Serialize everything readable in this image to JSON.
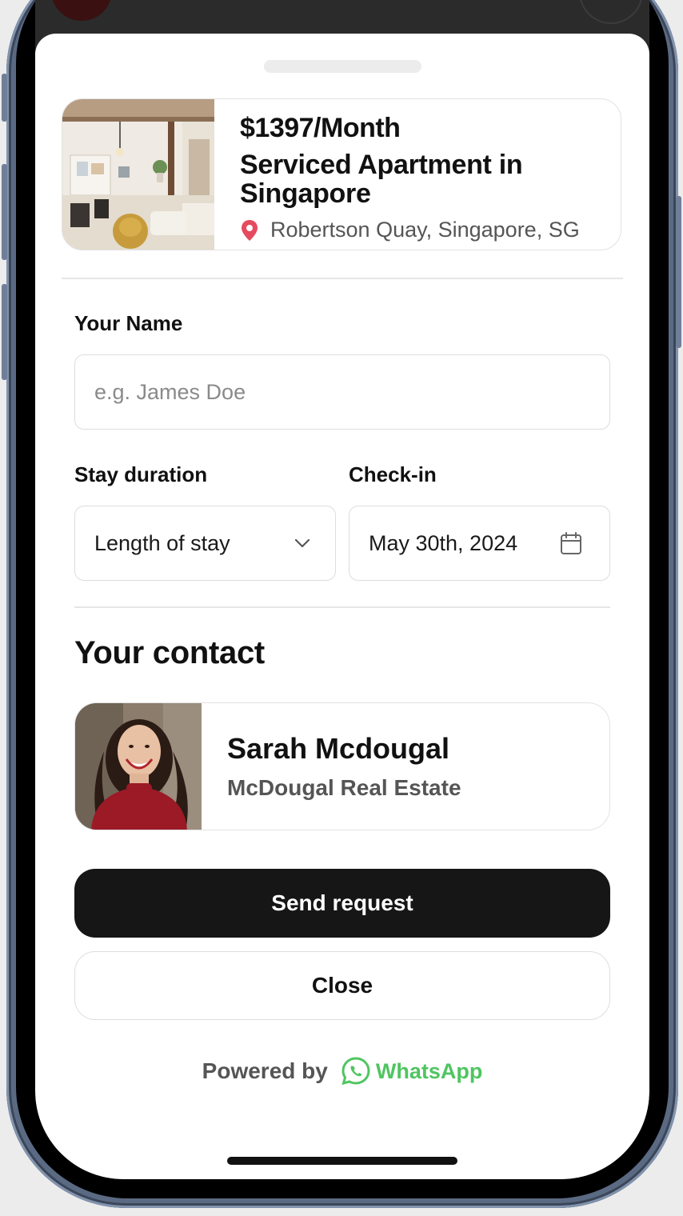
{
  "listing": {
    "price": "$1397/Month",
    "title": "Serviced Apartment in Singapore",
    "location": "Robertson Quay, Singapore, SG"
  },
  "form": {
    "name_label": "Your Name",
    "name_placeholder": "e.g. James Doe",
    "name_value": "",
    "duration_label": "Stay duration",
    "duration_value": "Length of stay",
    "checkin_label": "Check-in",
    "checkin_value": "May 30th, 2024"
  },
  "contact": {
    "section_title": "Your contact",
    "name": "Sarah Mcdougal",
    "company": "McDougal Real Estate"
  },
  "actions": {
    "send_label": "Send request",
    "close_label": "Close"
  },
  "footer": {
    "powered_by": "Powered by",
    "brand": "WhatsApp"
  },
  "colors": {
    "primary_button": "#161616",
    "location_pin": "#e64a5f",
    "whatsapp_green": "#4fc561"
  },
  "icons": {
    "location": "map-pin-icon",
    "duration": "chevron-down-icon",
    "checkin": "calendar-icon",
    "brand": "whatsapp-logo-icon"
  }
}
